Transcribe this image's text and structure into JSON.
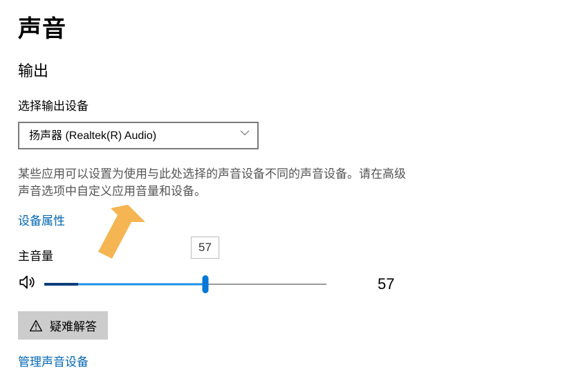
{
  "page_title": "声音",
  "output": {
    "heading": "输出",
    "device_label": "选择输出设备",
    "device_selected": "扬声器 (Realtek(R) Audio)",
    "description": "某些应用可以设置为使用与此处选择的声音设备不同的声音设备。请在高级声音选项中自定义应用音量和设备。",
    "device_props_link": "设备属性"
  },
  "volume": {
    "label": "主音量",
    "value": 57,
    "tooltip": "57",
    "percent_of_track_dark": 12,
    "icon_name": "speaker-icon"
  },
  "troubleshoot": {
    "label": "疑难解答",
    "icon_name": "warning-icon"
  },
  "manage_devices_link": "管理声音设备",
  "colors": {
    "link": "#0066b4",
    "accent": "#0078d7"
  }
}
